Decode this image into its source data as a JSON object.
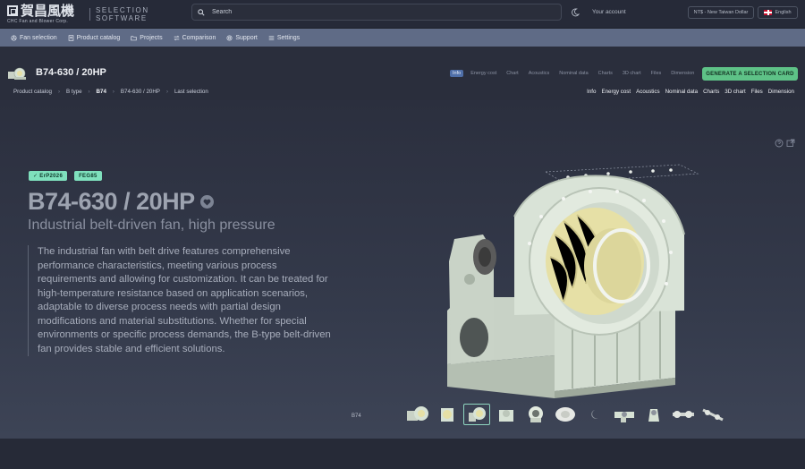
{
  "header": {
    "logo_text": "賀昌風機",
    "logo_subtext": "CHC Fan and Blower Corp.",
    "app_name": "SELECTION SOFTWARE",
    "search_placeholder": "Search",
    "account_label": "Your account",
    "currency_label": "NT$ - New Taiwan Dollar",
    "language_label": "English"
  },
  "nav": {
    "items": [
      {
        "label": "Fan selection",
        "icon": "fan-icon"
      },
      {
        "label": "Product catalog",
        "icon": "catalog-icon"
      },
      {
        "label": "Projects",
        "icon": "folder-icon"
      },
      {
        "label": "Comparison",
        "icon": "compare-icon"
      },
      {
        "label": "Support",
        "icon": "support-icon"
      },
      {
        "label": "Settings",
        "icon": "settings-icon"
      }
    ]
  },
  "product_header": {
    "title": "B74-630 / 20HP",
    "tabs": [
      "Info",
      "Energy cost",
      "Chart",
      "Acoustics",
      "Nominal data",
      "Charts",
      "3D chart",
      "Files",
      "Dimension"
    ],
    "active_tab": "Info",
    "generate_button": "GENERATE A SELECTION CARD",
    "breadcrumb": [
      "Product catalog",
      "B type",
      "B74",
      "B74-630 / 20HP",
      "Last selection"
    ],
    "subtabs": [
      "Info",
      "Energy cost",
      "Acoustics",
      "Nominal data",
      "Charts",
      "3D chart",
      "Files",
      "Dimension"
    ]
  },
  "hero": {
    "badges": [
      "ErP2026",
      "FEG85"
    ],
    "title": "B74-630 / 20HP",
    "subtitle": "Industrial belt-driven fan, high pressure",
    "description": "The industrial fan with belt drive features comprehensive performance characteristics, meeting various process requirements and allowing for customization. It can be treated for high-temperature resistance based on application scenarios, adaptable to diverse process needs with partial design modifications and material substitutions. Whether for special environments or specific process demands, the B-type belt-driven fan provides stable and efficient solutions.",
    "gallery_label": "B74",
    "gallery_count": 11,
    "gallery_selected_index": 2
  },
  "colors": {
    "accent_green": "#5ec287",
    "badge_green": "#7fe0bd",
    "nav_blue": "#5f6b86",
    "active_tab": "#4f6fa8",
    "fan_body": "#d7e2d5",
    "impeller": "#e6e0a6"
  }
}
